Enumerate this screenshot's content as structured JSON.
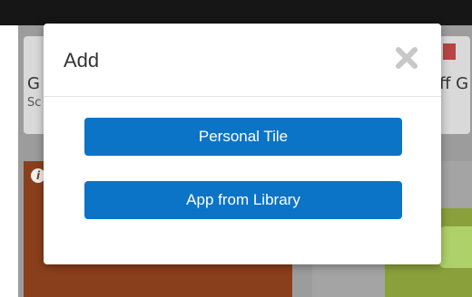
{
  "background": {
    "card_left": {
      "title": "G",
      "subtitle": "Sc"
    },
    "card_right": {
      "title": "ff G"
    },
    "info_badge": "i"
  },
  "dialog": {
    "title": "Add",
    "close_icon": "close-icon",
    "buttons": [
      {
        "label": "Personal Tile"
      },
      {
        "label": "App from Library"
      }
    ]
  },
  "colors": {
    "primary_button": "#0b74c6",
    "overlay": "#9c9c9c",
    "topbar": "#161616"
  }
}
